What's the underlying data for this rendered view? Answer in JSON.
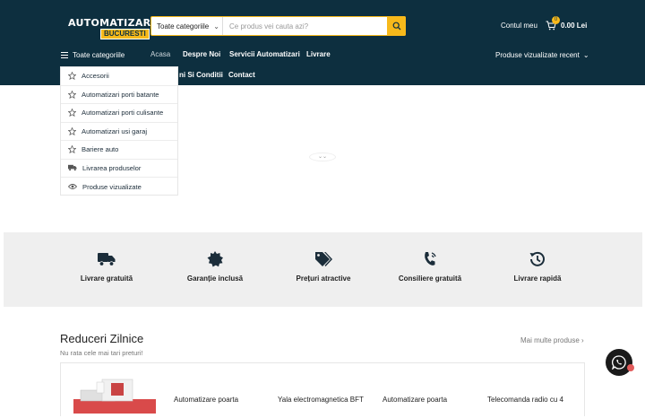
{
  "colors": {
    "header_bg": "#0d2f3f",
    "accent": "#f7b91b",
    "feature_bg": "#efefef"
  },
  "logo": {
    "line1": "AUTOMATIZARI",
    "line2": "BUCURESTI"
  },
  "search": {
    "category_label": "Toate categoriile",
    "placeholder": "Ce produs vei cauta azi?"
  },
  "account": {
    "label": "Contul meu"
  },
  "cart": {
    "count": "0",
    "total": "0.00 Lei"
  },
  "nav": {
    "all_categories": "Toate categoriile",
    "items": [
      "Acasa",
      "Despre Noi",
      "Servicii Automatizari",
      "Livrare",
      "Termeni Si Conditii",
      "Contact"
    ],
    "visible_termeni": "ni Si Conditii",
    "recent": "Produse vizualizate recent"
  },
  "dropdown": {
    "items": [
      {
        "label": "Accesorii",
        "icon": "star-icon"
      },
      {
        "label": "Automatizari porti batante",
        "icon": "star-icon"
      },
      {
        "label": "Automatizari porti culisante",
        "icon": "star-icon"
      },
      {
        "label": "Automatizari usi garaj",
        "icon": "star-icon"
      },
      {
        "label": "Bariere auto",
        "icon": "star-icon"
      },
      {
        "label": "Livrarea produselor",
        "icon": "truck-icon"
      },
      {
        "label": "Produse vizualizate",
        "icon": "eye-icon"
      }
    ]
  },
  "features": [
    {
      "label": "Livrare gratuită",
      "icon": "truck-icon"
    },
    {
      "label": "Garanție inclusă",
      "icon": "badge-icon"
    },
    {
      "label": "Prețuri atractive",
      "icon": "tags-icon"
    },
    {
      "label": "Consiliere gratuită",
      "icon": "phone-icon"
    },
    {
      "label": "Livrare rapidă",
      "icon": "history-icon"
    }
  ],
  "section": {
    "title": "Reduceri Zilnice",
    "subtitle": "Nu rata cele mai tari preturi!",
    "more": "Mai multe produse"
  },
  "products": [
    {
      "name": "Automatizare poarta"
    },
    {
      "name": "Yala electromagnetica BFT"
    },
    {
      "name": "Automatizare poarta"
    },
    {
      "name": "Telecomanda radio cu 4"
    }
  ]
}
